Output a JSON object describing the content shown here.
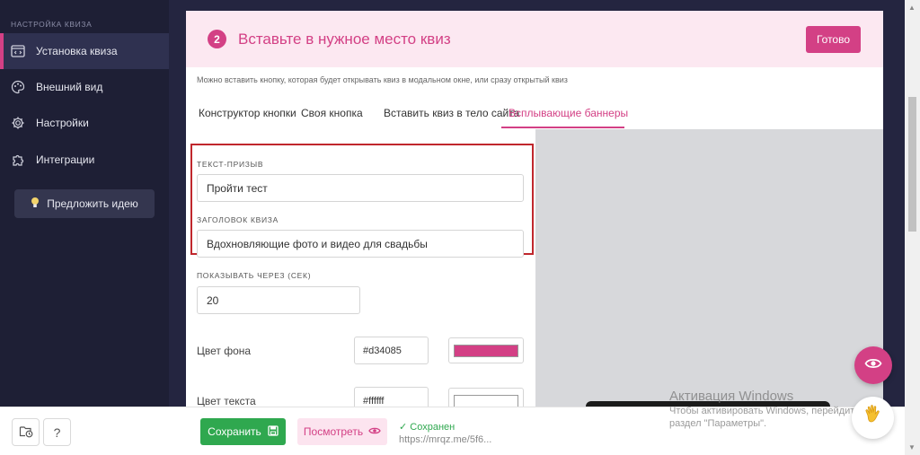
{
  "sidebar": {
    "section_title": "НАСТРОЙКА КВИЗА",
    "items": [
      {
        "label": "Установка квиза",
        "icon": "code-window-icon"
      },
      {
        "label": "Внешний вид",
        "icon": "palette-icon"
      },
      {
        "label": "Настройки",
        "icon": "gear-icon"
      },
      {
        "label": "Интеграции",
        "icon": "puzzle-icon"
      }
    ],
    "suggest_label": "Предложить идею"
  },
  "header": {
    "step": "2",
    "title": "Вставьте в нужное место квиз",
    "ready_label": "Готово"
  },
  "hint": "Можно вставить кнопку, которая будет открывать квиз в модальном окне, или сразу открытый квиз",
  "tabs": [
    {
      "label": "Конструктор кнопки"
    },
    {
      "label": "Своя кнопка"
    },
    {
      "label": "Вставить квиз в тело сайта"
    },
    {
      "label": "Всплывающие баннеры"
    }
  ],
  "form": {
    "cta_label": "ТЕКСТ-ПРИЗЫВ",
    "cta_value": "Пройти тест",
    "title_label": "ЗАГОЛОВОК КВИЗА",
    "title_value": "Вдохновляющие фото и видео для свадьбы",
    "delay_label": "ПОКАЗЫВАТЬ ЧЕРЕЗ (СЕК)",
    "delay_value": "20",
    "bg_color_label": "Цвет фона",
    "bg_color_value": "#d34085",
    "text_color_label": "Цвет текста",
    "text_color_value": "#ffffff"
  },
  "bottom": {
    "save_label": "Сохранить",
    "preview_label": "Посмотреть",
    "saved_status": "✓ Сохранен",
    "url": "https://mrqz.me/5f6..."
  },
  "watermark": {
    "title": "Активация Windows",
    "line1": "Чтобы активировать Windows, перейдите в",
    "line2": "раздел \"Параметры\"."
  },
  "colors": {
    "accent": "#d34085",
    "sidebar_bg": "#1e1f35",
    "save_green": "#2fa84f",
    "highlight_red": "#c0272d"
  }
}
